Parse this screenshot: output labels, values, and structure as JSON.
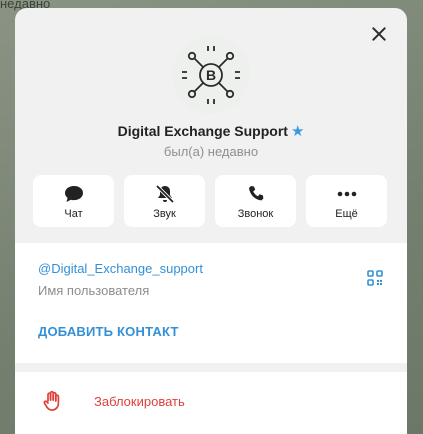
{
  "backdrop": {
    "partial_text": "недавно"
  },
  "profile": {
    "name": "Digital Exchange Support",
    "status": "был(а) недавно",
    "verified_icon": "star-icon",
    "accent_color": "#3390d6"
  },
  "actions": [
    {
      "label": "Чат",
      "icon": "chat-bubble-icon"
    },
    {
      "label": "Звук",
      "icon": "bell-muted-icon"
    },
    {
      "label": "Звонок",
      "icon": "phone-icon"
    },
    {
      "label": "Ещё",
      "icon": "more-dots-icon"
    }
  ],
  "info": {
    "username": "@Digital_Exchange_support",
    "username_caption": "Имя пользователя",
    "add_contact": "ДОБАВИТЬ КОНТАКТ",
    "qr_icon": "qr-code-icon"
  },
  "block": {
    "label": "Заблокировать",
    "icon": "hand-stop-icon",
    "color": "#e0403a"
  }
}
